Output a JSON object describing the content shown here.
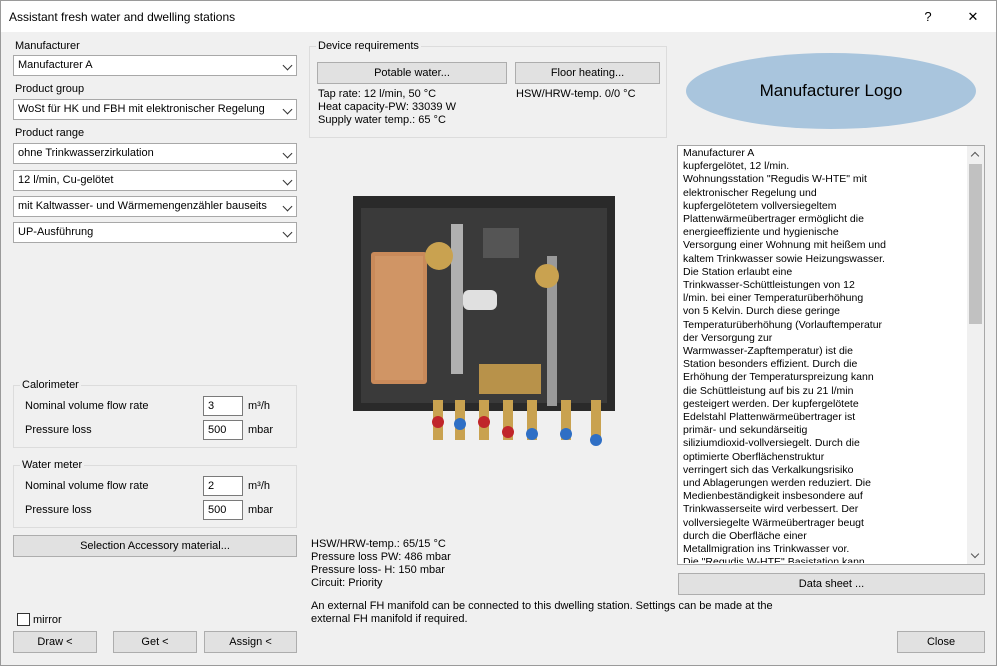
{
  "window": {
    "title": "Assistant fresh water and dwelling stations",
    "help": "?",
    "close": "✕"
  },
  "left": {
    "manufacturer_label": "Manufacturer",
    "manufacturer_value": "Manufacturer A",
    "product_group_label": "Product group",
    "product_group_value": "WoSt für HK und FBH mit elektronischer Regelung",
    "product_range_label": "Product range",
    "range_options": [
      "ohne Trinkwasserzirkulation",
      "12 l/min, Cu-gelötet",
      "mit Kaltwasser- und Wärmemengenzähler bauseits",
      "UP-Ausführung"
    ]
  },
  "calorimeter": {
    "title": "Calorimeter",
    "flow_label": "Nominal volume flow rate",
    "flow_value": "3",
    "flow_unit": "m³/h",
    "loss_label": "Pressure loss",
    "loss_value": "500",
    "loss_unit": "mbar"
  },
  "water_meter": {
    "title": "Water meter",
    "flow_label": "Nominal volume flow rate",
    "flow_value": "2",
    "flow_unit": "m³/h",
    "loss_label": "Pressure loss",
    "loss_value": "500",
    "loss_unit": "mbar"
  },
  "accessory_button": "Selection Accessory material...",
  "mirror_label": "mirror",
  "bottom_buttons": {
    "draw": "Draw <",
    "get": "Get <",
    "assign": "Assign <",
    "close": "Close"
  },
  "device": {
    "title": "Device requirements",
    "potable_button": "Potable water...",
    "floor_button": "Floor heating...",
    "tap_rate": "Tap rate: 12 l/min, 50 °C",
    "heat_capacity": "Heat capacity-PW: 33039 W",
    "supply_temp": "Supply water temp.: 65 °C",
    "hsw_temp": "HSW/HRW-temp. 0/0 °C"
  },
  "results": {
    "line1": "HSW/HRW-temp.: 65/15 °C",
    "line2": "Pressure loss PW: 486 mbar",
    "line3": "Pressure loss- H: 150 mbar",
    "line4": "Circuit: Priority"
  },
  "note_line1": "An external FH manifold can be connected to this dwelling station. Settings can be made at the",
  "note_line2": "external FH manifold if required.",
  "logo_text": "Manufacturer Logo",
  "description": [
    "Manufacturer A",
    "kupfergelötet, 12 l/min.",
    "Wohnungsstation \"Regudis W-HTE\" mit",
    "elektronischer Regelung und",
    "kupfergelötetem vollversiegeltem",
    "Plattenwärmeübertrager ermöglicht die",
    "energieeffiziente und hygienische",
    "Versorgung einer Wohnung mit heißem und",
    "kaltem Trinkwasser sowie Heizungswasser.",
    "Die Station erlaubt eine",
    "Trinkwasser-Schüttleistungen von 12",
    "l/min. bei einer Temperaturüberhöhung",
    "von 5 Kelvin. Durch diese geringe",
    "Temperaturüberhöhung (Vorlauftemperatur",
    "der Versorgung zur",
    "Warmwasser-Zapftemperatur) ist die",
    "Station besonders effizient. Durch die",
    "Erhöhung der Temperaturspreizung kann",
    "die Schüttleistung auf bis zu 21 l/min",
    "gesteigert werden. Der kupfergelötete",
    "Edelstahl Plattenwärmeübertrager ist",
    "primär- und sekundärseitig",
    "siliziumdioxid-vollversiegelt. Durch die",
    "optimierte Oberflächenstruktur",
    "verringert sich das Verkalkungsrisiko",
    "und Ablagerungen werden reduziert. Die",
    "Medienbeständigkeit insbesondere auf",
    "Trinkwasserseite wird verbessert. Der",
    "vollversiegelte Wärmeübertrager beugt",
    "durch die Oberfläche einer",
    "Metallmigration ins Trinkwasser vor.",
    "Die \"Regudis W-HTE\" Basistation kann"
  ],
  "data_sheet_button": "Data sheet ...",
  "colors": {
    "window_bg": "#f0f0f0",
    "logo_fill": "#a9c5dd",
    "button_bg": "#e1e1e1"
  }
}
